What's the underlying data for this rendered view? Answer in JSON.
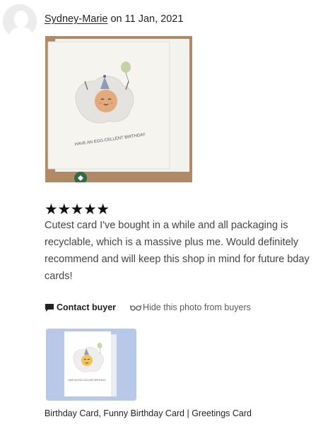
{
  "review": {
    "reviewer_name": "Sydney-Marie",
    "date_prefix": " on ",
    "date": "11 Jan, 2021",
    "rating": 5,
    "rating_display": "★★★★★",
    "text": "Cutest card I've bought in a while and all packaging is recyclable, which is a massive plus me. Would definitely recommend and will keep this shop in mind for future bday cards!",
    "photo": {
      "card_caption": "HAVE AN EGG-CELLENT BIRTHDAY"
    }
  },
  "actions": {
    "contact_label": "Contact buyer",
    "hide_photo_label": "Hide this photo from buyers"
  },
  "listing": {
    "title": "Birthday Card, Funny Birthday Card | Greetings Card",
    "thumbnail_caption": "HAVE AN EGG-CELLENT BIRTHDAY"
  },
  "colors": {
    "text_primary": "#222222",
    "text_body": "#444444",
    "text_muted": "#595959",
    "thumbnail_background": "#b8c8e8",
    "photo_background": "#b58e6b"
  },
  "icons": {
    "contact": "chat-bubble-icon",
    "hide": "glasses-icon",
    "avatar": "default-avatar-icon"
  }
}
